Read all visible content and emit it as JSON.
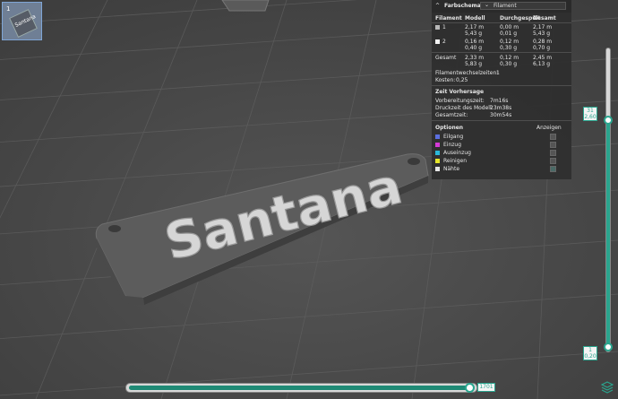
{
  "thumbnail": {
    "number": "1",
    "label": "Santana"
  },
  "plate_text": "Santana",
  "legend": {
    "header_label": "Farbschema",
    "scheme_selected": "Filament",
    "columns": [
      "Filament",
      "Modell",
      "Durchgespült",
      "Gesamt"
    ],
    "rows": [
      {
        "name": "1",
        "color": "#b8b8b8",
        "modell": [
          "2,17 m",
          "5,43 g"
        ],
        "durchgespuelt": [
          "0,00 m",
          "0,01 g"
        ],
        "gesamt": [
          "2,17 m",
          "5,43 g"
        ]
      },
      {
        "name": "2",
        "color": "#f2f2f2",
        "modell": [
          "0,16 m",
          "0,40 g"
        ],
        "durchgespuelt": [
          "0,12 m",
          "0,30 g"
        ],
        "gesamt": [
          "0,28 m",
          "0,70 g"
        ]
      }
    ],
    "total": {
      "label": "Gesamt",
      "modell": [
        "2,33 m",
        "5,83 g"
      ],
      "durchgespuelt": [
        "0,12 m",
        "0,30 g"
      ],
      "gesamt": [
        "2,45 m",
        "6,13 g"
      ]
    },
    "filament_changes_label": "Filamentwechselzeiten:",
    "filament_changes_value": "1",
    "cost_label": "Kosten:",
    "cost_value": "0,25",
    "time_section_title": "Zeit Vorhersage",
    "prep_time_label": "Vorbereitungszeit:",
    "prep_time_value": "7m16s",
    "print_time_label": "Druckzeit des Modell:",
    "print_time_value": "23m38s",
    "total_time_label": "Gesamtzeit:",
    "total_time_value": "30m54s",
    "options_title": "Optionen",
    "show_title": "Anzeigen",
    "options": [
      {
        "label": "Eilgang",
        "color": "#5b6fe0"
      },
      {
        "label": "Einzug",
        "color": "#d43ad6"
      },
      {
        "label": "Auseinzug",
        "color": "#2ab8d8"
      },
      {
        "label": "Reinigen",
        "color": "#e6e62a"
      },
      {
        "label": "Nähte",
        "color": "#e6e6e6"
      }
    ]
  },
  "vslider": {
    "top_layer": "31",
    "top_height": "2,60",
    "bottom_layer": "1",
    "bottom_height": "0,20"
  },
  "hslider": {
    "value": "1701"
  },
  "icons": {
    "layers": "layers-icon",
    "chevron": "chevron-down-icon",
    "collapse": "collapse-arrow-icon"
  }
}
